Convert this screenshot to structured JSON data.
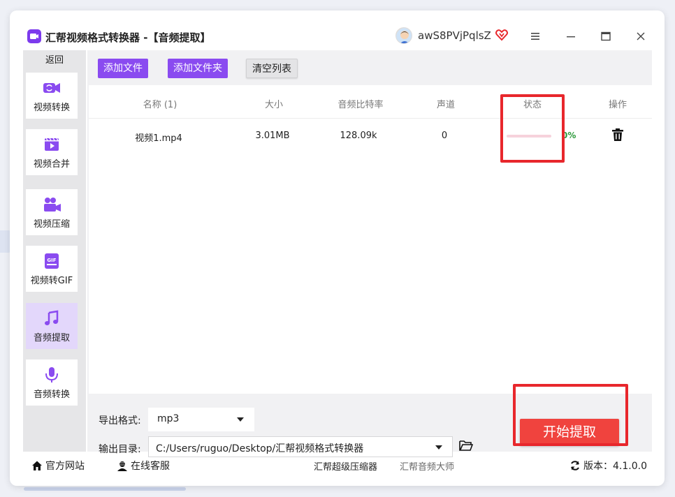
{
  "window": {
    "title": "汇帮视频格式转换器 -【音频提取】",
    "username": "awS8PVjPqlsZ",
    "controls": [
      "menu-icon",
      "minimize-icon",
      "maximize-icon",
      "close-icon"
    ]
  },
  "sidebar": {
    "back_label": "返回",
    "items": [
      {
        "label": "视频转换",
        "icon": "video-convert-icon",
        "active": false
      },
      {
        "label": "视频合并",
        "icon": "video-merge-icon",
        "active": false
      },
      {
        "label": "视频压缩",
        "icon": "video-compress-icon",
        "active": false
      },
      {
        "label": "视频转GIF",
        "icon": "gif-icon",
        "active": false
      },
      {
        "label": "音频提取",
        "icon": "music-note-icon",
        "active": true
      },
      {
        "label": "音频转换",
        "icon": "microphone-icon",
        "active": false
      }
    ]
  },
  "toolbar": {
    "add_file": "添加文件",
    "add_folder": "添加文件夹",
    "clear_list": "清空列表"
  },
  "table": {
    "headers": {
      "name": "名称 (1)",
      "size": "大小",
      "bitrate": "音频比特率",
      "channel": "声道",
      "status": "状态",
      "action": "操作"
    },
    "rows": [
      {
        "name": "视频1.mp4",
        "size": "3.01MB",
        "bitrate": "128.09k",
        "channel": "0",
        "progress_percent": 0,
        "status_text": "0%",
        "action_icon": "trash-icon"
      }
    ]
  },
  "output": {
    "format_label": "导出格式:",
    "format_value": "mp3",
    "dir_label": "输出目录:",
    "dir_value": "C:/Users/ruguo/Desktop/汇帮视频格式转换器"
  },
  "start_button": "开始提取",
  "footer": {
    "website": "官方网站",
    "support": "在线客服",
    "link1": "汇帮超级压缩器",
    "link2": "汇帮音频大师",
    "version": "版本：4.1.0.0"
  },
  "colors": {
    "accent_purple": "#8a4bf0",
    "start_red": "#f0433e",
    "highlight_red": "#e8272c",
    "progress_pink": "#f08aa7",
    "status_green": "#2e9a3c"
  }
}
